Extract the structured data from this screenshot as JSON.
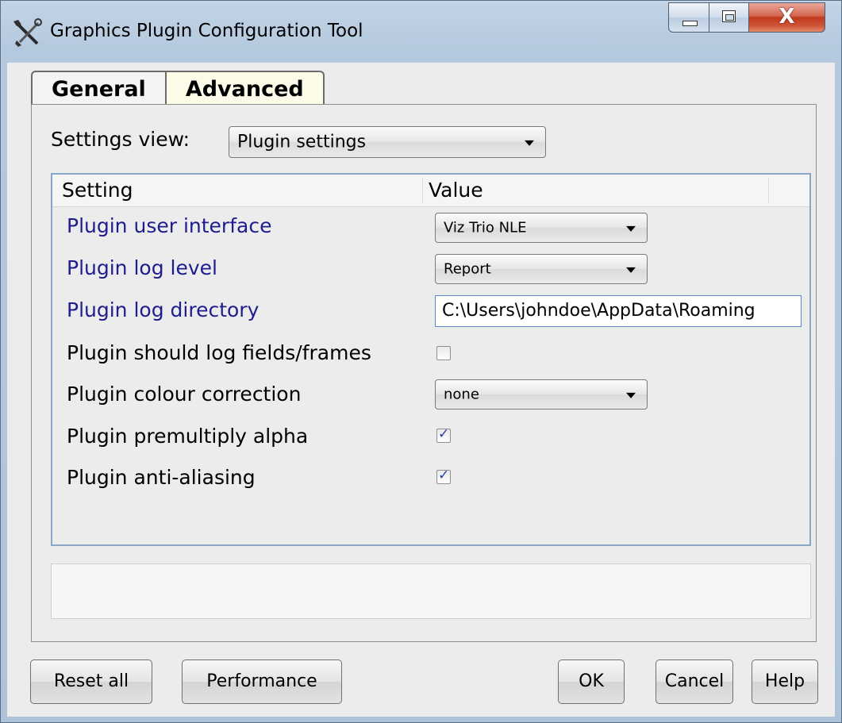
{
  "window": {
    "title": "Graphics Plugin Configuration Tool",
    "close_glyph": "X"
  },
  "tabs": [
    {
      "label": "General",
      "selected": false
    },
    {
      "label": "Advanced",
      "selected": true
    }
  ],
  "settings_view": {
    "label": "Settings view:",
    "selected": "Plugin settings"
  },
  "grid": {
    "columns": [
      "Setting",
      "Value"
    ],
    "rows": [
      {
        "label": "Plugin user interface",
        "type": "combo",
        "value": "Viz Trio NLE",
        "modified": true
      },
      {
        "label": "Plugin log level",
        "type": "combo",
        "value": "Report",
        "modified": true
      },
      {
        "label": "Plugin log directory",
        "type": "text",
        "value": "C:\\Users\\johndoe\\AppData\\Roaming",
        "modified": true
      },
      {
        "label": "Plugin should log fields/frames",
        "type": "checkbox",
        "checked": false,
        "modified": false
      },
      {
        "label": "Plugin colour correction",
        "type": "combo",
        "value": "none",
        "modified": false
      },
      {
        "label": "Plugin premultiply alpha",
        "type": "checkbox",
        "checked": true,
        "modified": false
      },
      {
        "label": "Plugin anti-aliasing",
        "type": "checkbox",
        "checked": true,
        "modified": false
      }
    ]
  },
  "buttons": {
    "reset_all": "Reset all",
    "performance": "Performance",
    "ok": "OK",
    "cancel": "Cancel",
    "help": "Help"
  },
  "colors": {
    "modified_label": "#1d1d8f",
    "checkmark": "#253fa0",
    "close_button": "#c13a1e"
  },
  "icons": [
    "tools-icon",
    "minimize-icon",
    "maximize-icon",
    "close-icon",
    "dropdown-arrow-icon",
    "checkmark-icon"
  ]
}
